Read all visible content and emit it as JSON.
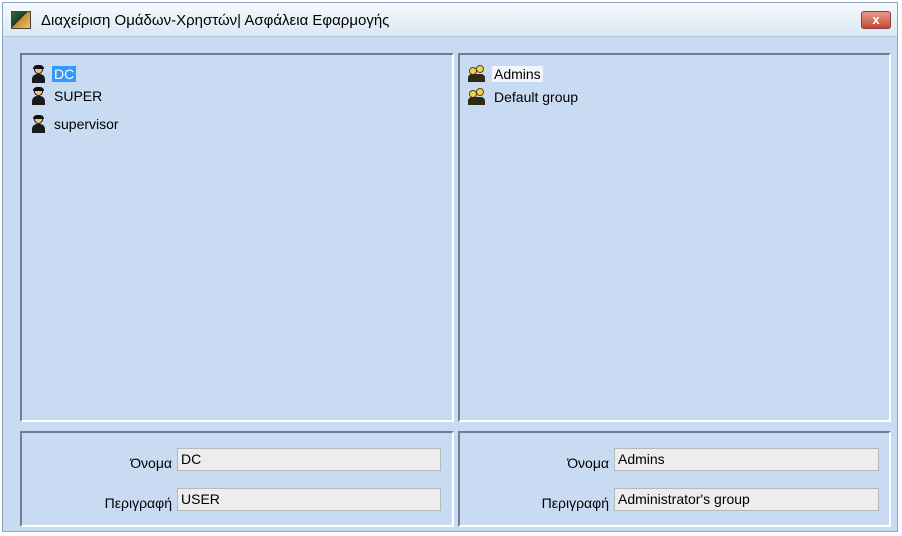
{
  "window": {
    "title": "Διαχείριση Ομάδων-Χρηστών| Ασφάλεια Εφαρμογής",
    "close_label": "x"
  },
  "users": {
    "items": [
      {
        "label": "DC",
        "icon": "user-icon",
        "selected": true
      },
      {
        "label": "SUPER",
        "icon": "user-icon",
        "selected": false
      },
      {
        "label": "supervisor",
        "icon": "user-icon",
        "selected": false
      }
    ]
  },
  "groups": {
    "items": [
      {
        "label": "Admins",
        "icon": "group-icon",
        "selected": true
      },
      {
        "label": "Default group",
        "icon": "group-icon",
        "selected": false
      }
    ]
  },
  "user_details": {
    "name_label": "Όνομα",
    "name_value": "DC",
    "description_label": "Περιγραφή",
    "description_value": "USER"
  },
  "group_details": {
    "name_label": "Όνομα",
    "name_value": "Admins",
    "description_label": "Περιγραφή",
    "description_value": "Administrator's group"
  },
  "colors": {
    "background": "#c9daf3",
    "selection": "#3399ff",
    "field": "#ededed"
  }
}
